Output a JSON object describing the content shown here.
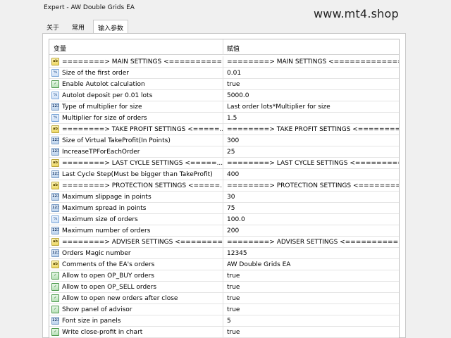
{
  "window": {
    "title": "Expert - AW Double Grids EA"
  },
  "watermark": "www.mt4.shop",
  "tabs": [
    {
      "label": "关于"
    },
    {
      "label": "常用"
    },
    {
      "label": "输入参数"
    }
  ],
  "table": {
    "headers": {
      "variable": "变量",
      "value": "赋值"
    },
    "rows": [
      {
        "icon": "ab",
        "name": "========> MAIN SETTINGS  <===========...",
        "value": "========> MAIN SETTINGS  <================..."
      },
      {
        "icon": "dbl",
        "name": "Size of the first order",
        "value": "0.01"
      },
      {
        "icon": "bool",
        "name": "Enable Autolot  calculation",
        "value": "true"
      },
      {
        "icon": "dbl",
        "name": "Autolot deposit per 0.01 lots",
        "value": "5000.0"
      },
      {
        "icon": "int",
        "name": "Type of multiplier for size",
        "value": "Last order lots*Multiplier for size"
      },
      {
        "icon": "dbl",
        "name": "Multiplier for size of orders",
        "value": "1.5"
      },
      {
        "icon": "ab",
        "name": "========> TAKE PROFIT SETTINGS  <=====...",
        "value": "========> TAKE PROFIT SETTINGS  <=========..."
      },
      {
        "icon": "int",
        "name": "Size of Virtual TakeProfit(In Points)",
        "value": "300"
      },
      {
        "icon": "int",
        "name": "IncreaseTPForEachOrder",
        "value": "25"
      },
      {
        "icon": "ab",
        "name": "========> LAST CYCLE SETTINGS  <=====...",
        "value": "========> LAST CYCLE SETTINGS  <==========..."
      },
      {
        "icon": "int",
        "name": "Last Cycle Step(Must be bigger than TakeProfit)",
        "value": "400"
      },
      {
        "icon": "ab",
        "name": "========> PROTECTION SETTINGS  <=====...",
        "value": "========> PROTECTION SETTINGS  <=========..."
      },
      {
        "icon": "int",
        "name": "Maximum slippage in points",
        "value": "30"
      },
      {
        "icon": "int",
        "name": "Maximum spread in points",
        "value": "75"
      },
      {
        "icon": "dbl",
        "name": "Maximum size of orders",
        "value": "100.0"
      },
      {
        "icon": "int",
        "name": "Maximum number of orders",
        "value": "200"
      },
      {
        "icon": "ab",
        "name": "========> ADVISER SETTINGS  <=========...",
        "value": "========> ADVISER SETTINGS  <============..."
      },
      {
        "icon": "int",
        "name": "Orders Magic number",
        "value": "12345"
      },
      {
        "icon": "ab",
        "name": "Comments of the EA's orders",
        "value": "AW Double Grids EA"
      },
      {
        "icon": "bool",
        "name": "Allow to open OP_BUY orders",
        "value": "true"
      },
      {
        "icon": "bool",
        "name": "Allow to open OP_SELL orders",
        "value": "true"
      },
      {
        "icon": "bool",
        "name": "Allow to open new orders after close",
        "value": "true"
      },
      {
        "icon": "bool",
        "name": "Show panel of advisor",
        "value": "true"
      },
      {
        "icon": "int",
        "name": "Font size in panels",
        "value": "5"
      },
      {
        "icon": "bool",
        "name": "Write close-profit in chart",
        "value": "true"
      }
    ]
  }
}
